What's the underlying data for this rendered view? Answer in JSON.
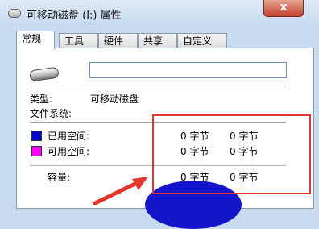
{
  "window": {
    "title": "可移动磁盘 (I:) 属性",
    "close_label": "x"
  },
  "tabs": [
    {
      "label": "常规"
    },
    {
      "label": "工具"
    },
    {
      "label": "硬件"
    },
    {
      "label": "共享"
    },
    {
      "label": "自定义"
    }
  ],
  "general": {
    "drive_name_value": "",
    "type_label": "类型:",
    "type_value": "可移动磁盘",
    "filesystem_label": "文件系统:",
    "filesystem_value": "",
    "used": {
      "label": "已用空间:",
      "bytes": "0 字节",
      "size": "0 字节",
      "color": "#0000c8"
    },
    "free": {
      "label": "可用空间:",
      "bytes": "0 字节",
      "size": "0 字节",
      "color": "#ff00ff"
    },
    "capacity": {
      "label": "容量:",
      "bytes": "0 字节",
      "size": "0 字节"
    }
  },
  "annotation": {
    "box_color": "#e0362f",
    "arrow_color": "#e0362f"
  },
  "pie_color": "#1414c8"
}
